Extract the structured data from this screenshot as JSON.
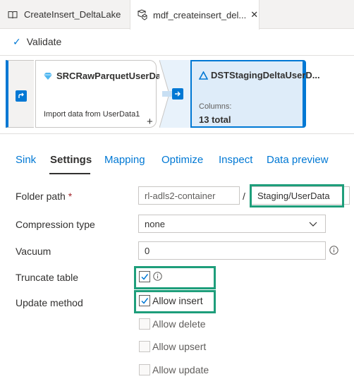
{
  "tabs": [
    {
      "label": "CreateInsert_DeltaLake",
      "icon": "book-icon"
    },
    {
      "label": "mdf_createinsert_del...",
      "icon": "dataflow-icon",
      "close": "✕"
    }
  ],
  "toolbar": {
    "validate_label": "Validate"
  },
  "canvas": {
    "source": {
      "title": "SRCRawParquetUserData",
      "description": "Import data from UserData1"
    },
    "add_symbol": "+",
    "sink": {
      "title": "DSTStagingDeltaUserD...",
      "columns_label": "Columns:",
      "columns_value": "13 total"
    }
  },
  "settings_tabs": [
    "Sink",
    "Settings",
    "Mapping",
    "Optimize",
    "Inspect",
    "Data preview"
  ],
  "active_tab": "Settings",
  "form": {
    "folder_path": {
      "label": "Folder path",
      "required_mark": "*",
      "container": "rl-adls2-container",
      "separator": "/",
      "path": "Staging/UserData"
    },
    "compression": {
      "label": "Compression type",
      "value": "none"
    },
    "vacuum": {
      "label": "Vacuum",
      "value": "0"
    },
    "truncate": {
      "label": "Truncate table",
      "checked": true
    },
    "update_method": {
      "label": "Update method",
      "options": [
        {
          "label": "Allow insert",
          "checked": true
        },
        {
          "label": "Allow delete",
          "checked": false
        },
        {
          "label": "Allow upsert",
          "checked": false
        },
        {
          "label": "Allow update",
          "checked": false
        }
      ]
    }
  },
  "colors": {
    "accent": "#0078d4",
    "highlight": "#1e9e7b",
    "required": "#a4262c"
  }
}
